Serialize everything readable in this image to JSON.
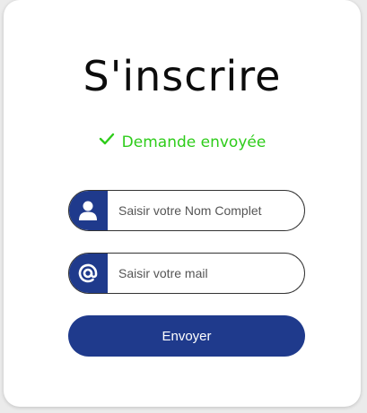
{
  "form": {
    "title": "S'inscrire",
    "status_message": "Demande envoyée",
    "status_icon": "check-icon",
    "name_field": {
      "icon": "user-icon",
      "placeholder": "Saisir votre Nom Complet",
      "value": ""
    },
    "mail_field": {
      "icon": "at-sign-icon",
      "placeholder": "Saisir votre mail",
      "value": ""
    },
    "submit_label": "Envoyer"
  },
  "colors": {
    "accent": "#1f3a8c",
    "success": "#2ecc1a",
    "background": "#ebebeb",
    "card": "#ffffff"
  }
}
